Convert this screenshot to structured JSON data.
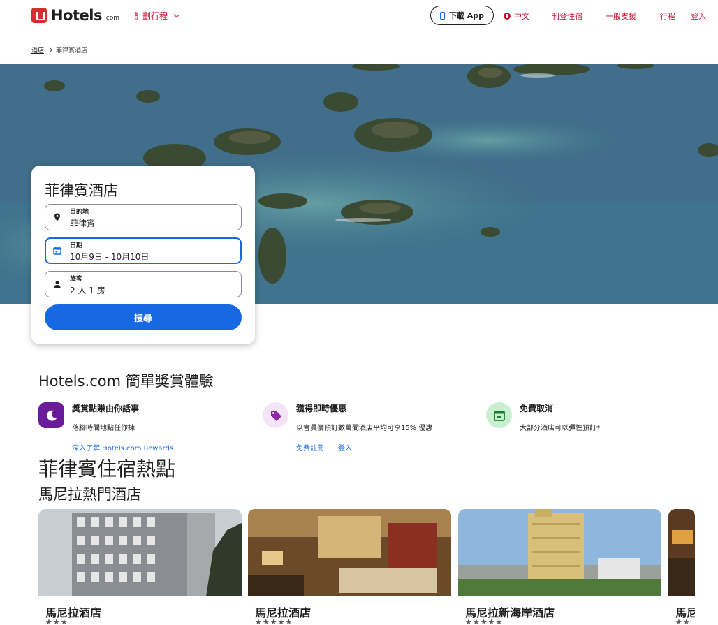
{
  "header": {
    "logo_text": "Hotels",
    "logo_suffix": ".com",
    "plan_trip": "計劃行程",
    "download_app": "下載 App",
    "language": "中文",
    "list_property": "刊登住宿",
    "support": "一般支援",
    "trips": "行程",
    "sign_in": "登入"
  },
  "breadcrumb": {
    "home": "酒店",
    "current": "菲律賓酒店"
  },
  "search": {
    "title": "菲律賓酒店",
    "destination_label": "目的地",
    "destination_value": "菲律賓",
    "dates_label": "日期",
    "dates_value": "10月9日 - 10月10日",
    "travelers_label": "旅客",
    "travelers_value": "2 人 1 房",
    "search_button": "搜尋"
  },
  "rewards": {
    "title": "Hotels.com 簡單獎賞體驗",
    "items": [
      {
        "title": "獎賞點賺由你話事",
        "desc": "落腳時間地點任你揀",
        "icon": "moon-icon",
        "icon_bg": "#6a1b9a",
        "links": [
          "深入了解 Hotels.com Rewards"
        ]
      },
      {
        "title": "獲得即時優惠",
        "desc": "以會員價預訂數萬間酒店平均可享15% 優惠",
        "icon": "tag-icon",
        "icon_bg": "#f3e5f5",
        "links": [
          "免費註冊",
          "登入"
        ]
      },
      {
        "title": "免費取消",
        "desc": "大部分酒店可以彈性預訂*",
        "icon": "calendar-check-icon",
        "icon_bg": "#c8f0d0",
        "links": []
      }
    ]
  },
  "hotspots": {
    "title": "菲律賓住宿熱點",
    "subtitle": "馬尼拉熱門酒店",
    "cards": [
      {
        "name": "馬尼拉酒店",
        "stars": "★★★"
      },
      {
        "name": "馬尼拉酒店",
        "stars": "★★★★★"
      },
      {
        "name": "馬尼拉新海岸酒店",
        "stars": "★★★★★"
      },
      {
        "name": "馬尼",
        "stars": "★★"
      }
    ]
  },
  "colors": {
    "brand_red": "#c8102e",
    "primary_blue": "#1668e3"
  }
}
